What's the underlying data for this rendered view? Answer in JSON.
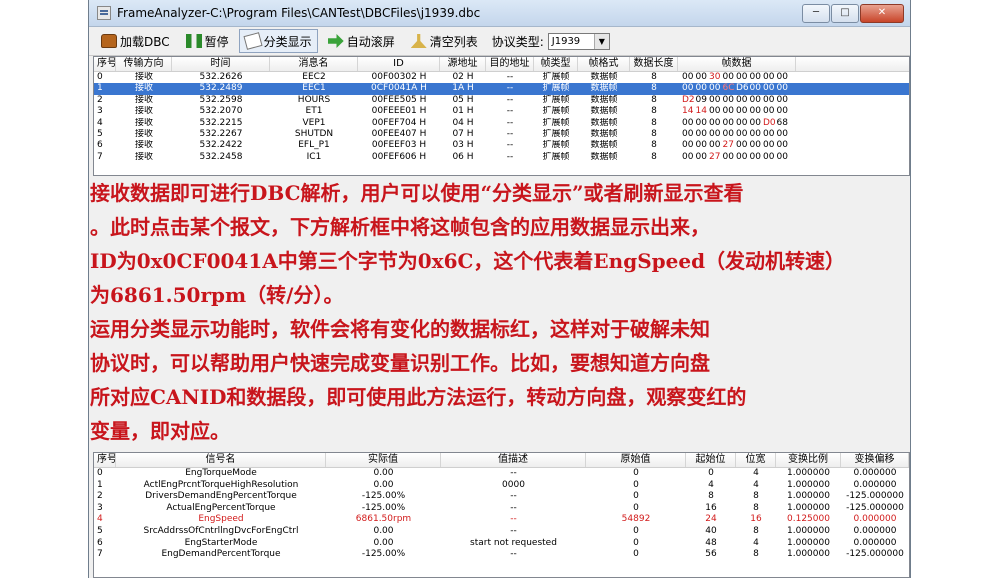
{
  "window": {
    "title": "FrameAnalyzer-C:\\Program Files\\CANTest\\DBCFiles\\j1939.dbc"
  },
  "toolbar": {
    "load_dbc": "加载DBC",
    "pause": "暂停",
    "classify": "分类显示",
    "auto_scroll": "自动滚屏",
    "clear_list": "清空列表",
    "protocol_label": "协议类型:",
    "protocol_value": "J1939"
  },
  "frames": {
    "columns": [
      "序号",
      "传输方向",
      "时间",
      "消息名",
      "ID",
      "源地址",
      "目的地址",
      "帧类型",
      "帧格式",
      "数据长度",
      "帧数据"
    ],
    "rows": [
      {
        "idx": "0",
        "dir": "接收",
        "time": "532.2626",
        "name": "EEC2",
        "id": "00F00302 H",
        "src": "02 H",
        "dst": "--",
        "type": "扩展帧",
        "fmt": "数据帧",
        "len": "8",
        "bytes": [
          "00",
          "00",
          "30",
          "00",
          "00",
          "00",
          "00",
          "00"
        ],
        "red": [
          false,
          false,
          true,
          false,
          false,
          false,
          false,
          false
        ]
      },
      {
        "idx": "1",
        "dir": "接收",
        "time": "532.2489",
        "name": "EEC1",
        "id": "0CF0041A H",
        "src": "1A H",
        "dst": "--",
        "type": "扩展帧",
        "fmt": "数据帧",
        "len": "8",
        "bytes": [
          "00",
          "00",
          "00",
          "6C",
          "D6",
          "00",
          "00",
          "00"
        ],
        "red": [
          false,
          false,
          false,
          true,
          false,
          false,
          false,
          false
        ]
      },
      {
        "idx": "2",
        "dir": "接收",
        "time": "532.2598",
        "name": "HOURS",
        "id": "00FEE505 H",
        "src": "05 H",
        "dst": "--",
        "type": "扩展帧",
        "fmt": "数据帧",
        "len": "8",
        "bytes": [
          "D2",
          "09",
          "00",
          "00",
          "00",
          "00",
          "00",
          "00"
        ],
        "red": [
          true,
          false,
          false,
          false,
          false,
          false,
          false,
          false
        ]
      },
      {
        "idx": "3",
        "dir": "接收",
        "time": "532.2070",
        "name": "ET1",
        "id": "00FEEE01 H",
        "src": "01 H",
        "dst": "--",
        "type": "扩展帧",
        "fmt": "数据帧",
        "len": "8",
        "bytes": [
          "14",
          "14",
          "00",
          "00",
          "00",
          "00",
          "00",
          "00"
        ],
        "red": [
          true,
          true,
          false,
          false,
          false,
          false,
          false,
          false
        ]
      },
      {
        "idx": "4",
        "dir": "接收",
        "time": "532.2215",
        "name": "VEP1",
        "id": "00FEF704 H",
        "src": "04 H",
        "dst": "--",
        "type": "扩展帧",
        "fmt": "数据帧",
        "len": "8",
        "bytes": [
          "00",
          "00",
          "00",
          "00",
          "00",
          "00",
          "D0",
          "68"
        ],
        "red": [
          false,
          false,
          false,
          false,
          false,
          false,
          true,
          false
        ]
      },
      {
        "idx": "5",
        "dir": "接收",
        "time": "532.2267",
        "name": "SHUTDN",
        "id": "00FEE407 H",
        "src": "07 H",
        "dst": "--",
        "type": "扩展帧",
        "fmt": "数据帧",
        "len": "8",
        "bytes": [
          "00",
          "00",
          "00",
          "00",
          "00",
          "00",
          "00",
          "00"
        ],
        "red": [
          false,
          false,
          false,
          false,
          false,
          false,
          false,
          false
        ]
      },
      {
        "idx": "6",
        "dir": "接收",
        "time": "532.2422",
        "name": "EFL_P1",
        "id": "00FEEF03 H",
        "src": "03 H",
        "dst": "--",
        "type": "扩展帧",
        "fmt": "数据帧",
        "len": "8",
        "bytes": [
          "00",
          "00",
          "00",
          "27",
          "00",
          "00",
          "00",
          "00"
        ],
        "red": [
          false,
          false,
          false,
          true,
          false,
          false,
          false,
          false
        ]
      },
      {
        "idx": "7",
        "dir": "接收",
        "time": "532.2458",
        "name": "IC1",
        "id": "00FEF606 H",
        "src": "06 H",
        "dst": "--",
        "type": "扩展帧",
        "fmt": "数据帧",
        "len": "8",
        "bytes": [
          "00",
          "00",
          "27",
          "00",
          "00",
          "00",
          "00",
          "00"
        ],
        "red": [
          false,
          false,
          true,
          false,
          false,
          false,
          false,
          false
        ]
      }
    ]
  },
  "annotation": {
    "lines": [
      "  接收数据即可进行DBC解析，用户可以使用“分类显示”或者刷新显示查看",
      "。此时点击某个报文，下方解析框中将这帧包含的应用数据显示出来，",
      "ID为0x0CF0041A中第三个字节为0x6C，这个代表着EngSpeed（发动机转速）",
      "为6861.50rpm（转/分）。",
      "  运用分类显示功能时，软件会将有变化的数据标红，这样对于破解未知",
      " 协议时，可以帮助用户快速完成变量识别工作。比如，要想知道方向盘",
      " 所对应CANID和数据段，即可使用此方法运行，转动方向盘，观察变红的",
      " 变量，即对应。"
    ]
  },
  "signals": {
    "columns": [
      "序号",
      "信号名",
      "实际值",
      "值描述",
      "原始值",
      "起始位",
      "位宽",
      "变换比例",
      "变换偏移"
    ],
    "rows": [
      {
        "idx": "0",
        "name": "EngTorqueMode",
        "value": "0.00",
        "desc": "--",
        "raw": "0",
        "start": "0",
        "width": "4",
        "scale": "1.000000",
        "offset": "0.000000",
        "hl": false
      },
      {
        "idx": "1",
        "name": "ActlEngPrcntTorqueHighResolution",
        "value": "0.00",
        "desc": "0000",
        "raw": "0",
        "start": "4",
        "width": "4",
        "scale": "1.000000",
        "offset": "0.000000",
        "hl": false
      },
      {
        "idx": "2",
        "name": "DriversDemandEngPercentTorque",
        "value": "-125.00%",
        "desc": "--",
        "raw": "0",
        "start": "8",
        "width": "8",
        "scale": "1.000000",
        "offset": "-125.000000",
        "hl": false
      },
      {
        "idx": "3",
        "name": "ActualEngPercentTorque",
        "value": "-125.00%",
        "desc": "--",
        "raw": "0",
        "start": "16",
        "width": "8",
        "scale": "1.000000",
        "offset": "-125.000000",
        "hl": false
      },
      {
        "idx": "4",
        "name": "EngSpeed",
        "value": "6861.50rpm",
        "desc": "--",
        "raw": "54892",
        "start": "24",
        "width": "16",
        "scale": "0.125000",
        "offset": "0.000000",
        "hl": true
      },
      {
        "idx": "5",
        "name": "SrcAddrssOfCntrllngDvcForEngCtrl",
        "value": "0.00",
        "desc": "--",
        "raw": "0",
        "start": "40",
        "width": "8",
        "scale": "1.000000",
        "offset": "0.000000",
        "hl": false
      },
      {
        "idx": "6",
        "name": "EngStarterMode",
        "value": "0.00",
        "desc": "start not requested",
        "raw": "0",
        "start": "48",
        "width": "4",
        "scale": "1.000000",
        "offset": "0.000000",
        "hl": false
      },
      {
        "idx": "7",
        "name": "EngDemandPercentTorque",
        "value": "-125.00%",
        "desc": "--",
        "raw": "0",
        "start": "56",
        "width": "8",
        "scale": "1.000000",
        "offset": "-125.000000",
        "hl": false
      }
    ]
  },
  "colors": {
    "selected_row": "#3a76d0",
    "changed_value": "#d21b1b",
    "annotation_text": "#c8151c"
  }
}
